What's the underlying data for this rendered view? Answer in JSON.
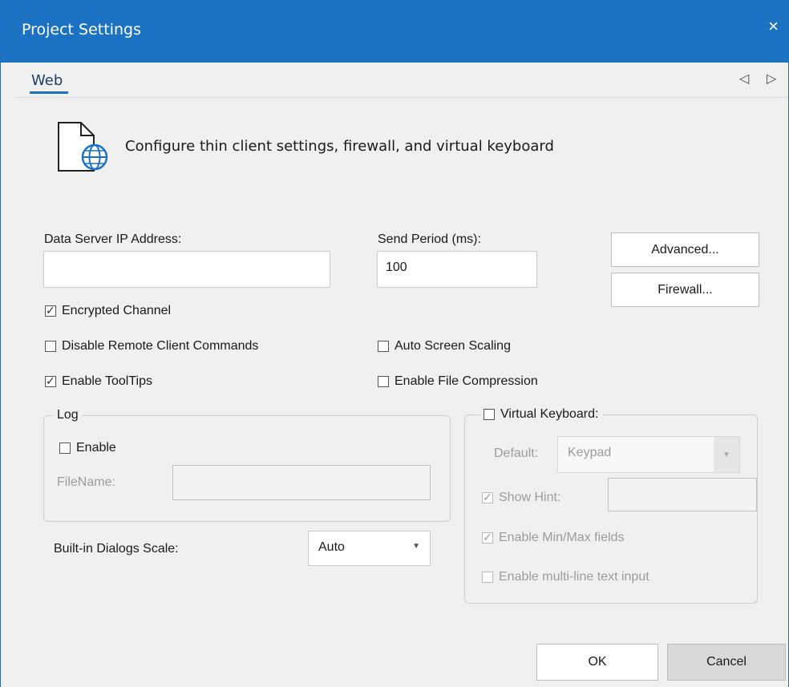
{
  "window": {
    "title": "Project Settings",
    "close_label": "×"
  },
  "tabs": {
    "active": "Web",
    "prev": "◁",
    "next": "▷"
  },
  "header": {
    "description": "Configure thin client settings, firewall, and virtual keyboard"
  },
  "fields": {
    "ip_label": "Data Server IP Address:",
    "ip_value": "",
    "period_label": "Send Period (ms):",
    "period_value": "100"
  },
  "buttons": {
    "advanced": "Advanced...",
    "firewall": "Firewall...",
    "ok": "OK",
    "cancel": "Cancel"
  },
  "options": {
    "encrypted": {
      "label": "Encrypted Channel",
      "checked": true
    },
    "disable_remote": {
      "label": "Disable Remote Client Commands",
      "checked": false
    },
    "auto_scaling": {
      "label": "Auto Screen Scaling",
      "checked": false
    },
    "tooltips": {
      "label": "Enable ToolTips",
      "checked": true
    },
    "compression": {
      "label": "Enable File Compression",
      "checked": false
    }
  },
  "log": {
    "legend": "Log",
    "enable_label": "Enable",
    "filename_label": "FileName:",
    "filename_value": ""
  },
  "dialogs_scale": {
    "label": "Built-in Dialogs Scale:",
    "value": "Auto"
  },
  "virtual_keyboard": {
    "legend": "Virtual Keyboard:",
    "default_label": "Default:",
    "default_value": "Keypad",
    "show_hint_label": "Show Hint:",
    "show_hint_value": "",
    "minmax_label": "Enable Min/Max fields",
    "multiline_label": "Enable multi-line text input"
  },
  "icons": {
    "header": "document-globe-icon"
  },
  "colors": {
    "accent": "#1b72c2",
    "disabled": "#9c9c9c"
  }
}
